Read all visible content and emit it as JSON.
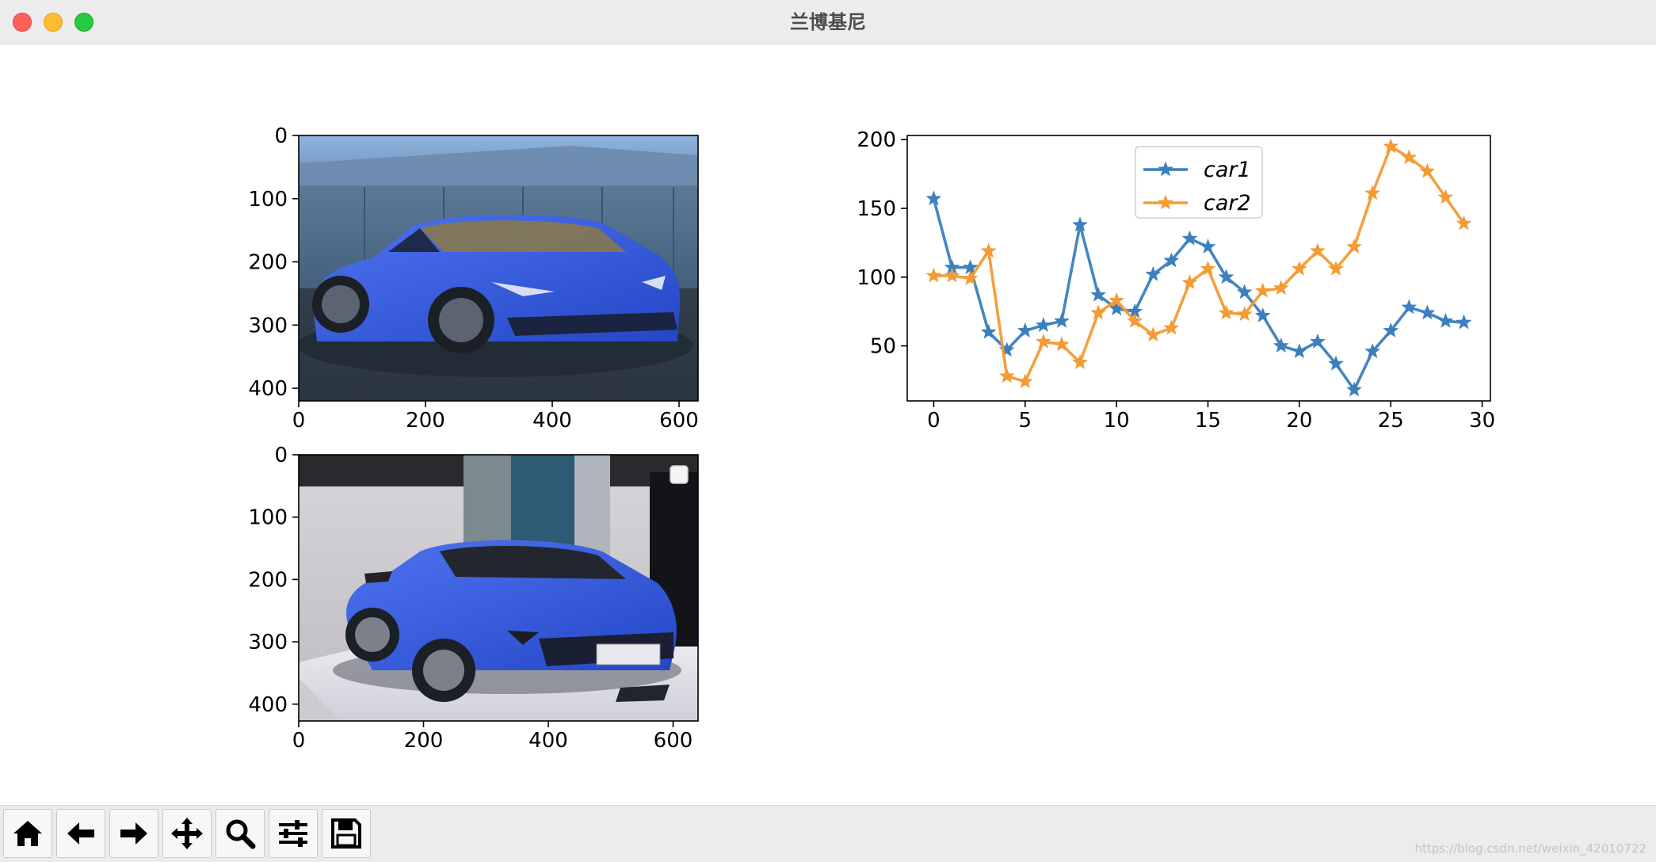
{
  "window": {
    "title": "兰博基尼"
  },
  "chart_data": [
    {
      "type": "image",
      "xticks": [
        "0",
        "200",
        "400",
        "600"
      ],
      "yticks": [
        "0",
        "100",
        "200",
        "300",
        "400"
      ],
      "xlim": [
        0,
        630
      ],
      "ylim": [
        420,
        0
      ],
      "image": "blue Lamborghini Huracán on asphalt in front of a concrete building"
    },
    {
      "type": "image",
      "xticks": [
        "0",
        "200",
        "400",
        "600"
      ],
      "yticks": [
        "0",
        "100",
        "200",
        "300",
        "400"
      ],
      "xlim": [
        0,
        640
      ],
      "ylim": [
        427,
        0
      ],
      "image": "blue Lamborghini Aventador S on a white showroom platform",
      "legend": "empty legend box, top-right"
    },
    {
      "type": "line",
      "x": [
        0,
        1,
        2,
        3,
        4,
        5,
        6,
        7,
        8,
        9,
        10,
        11,
        12,
        13,
        14,
        15,
        16,
        17,
        18,
        19,
        20,
        21,
        22,
        23,
        24,
        25,
        26,
        27,
        28,
        29
      ],
      "series": [
        {
          "name": "car1",
          "marker": "star",
          "color": "#3b80bd",
          "values": [
            157,
            107,
            107,
            60,
            47,
            61,
            65,
            68,
            138,
            87,
            77,
            75,
            102,
            112,
            128,
            122,
            100,
            89,
            72,
            50,
            46,
            53,
            37,
            18,
            46,
            61,
            78,
            74,
            68,
            67
          ]
        },
        {
          "name": "car2",
          "marker": "star",
          "color": "#f39b34",
          "values": [
            101,
            101,
            99,
            119,
            28,
            24,
            53,
            51,
            38,
            74,
            83,
            68,
            58,
            63,
            96,
            106,
            74,
            73,
            90,
            92,
            106,
            119,
            106,
            122,
            161,
            195,
            187,
            177,
            158,
            139
          ]
        }
      ],
      "xticks": [
        0,
        5,
        10,
        15,
        20,
        25,
        30
      ],
      "yticks": [
        50,
        100,
        150,
        200
      ],
      "xlim": [
        -1.45,
        30.45
      ],
      "ylim": [
        10,
        203
      ],
      "legend": "top-center",
      "grid": false,
      "title": "",
      "xlabel": "",
      "ylabel": ""
    }
  ],
  "toolbar": {
    "buttons": [
      {
        "name": "home-button",
        "icon": "home-icon"
      },
      {
        "name": "back-button",
        "icon": "arrow-left-icon"
      },
      {
        "name": "forward-button",
        "icon": "arrow-right-icon"
      },
      {
        "name": "pan-button",
        "icon": "move-icon"
      },
      {
        "name": "zoom-button",
        "icon": "magnifier-icon"
      },
      {
        "name": "configure-subplots-button",
        "icon": "sliders-icon"
      },
      {
        "name": "save-button",
        "icon": "floppy-disk-icon"
      }
    ]
  },
  "watermark": "https://blog.csdn.net/weixin_42010722"
}
